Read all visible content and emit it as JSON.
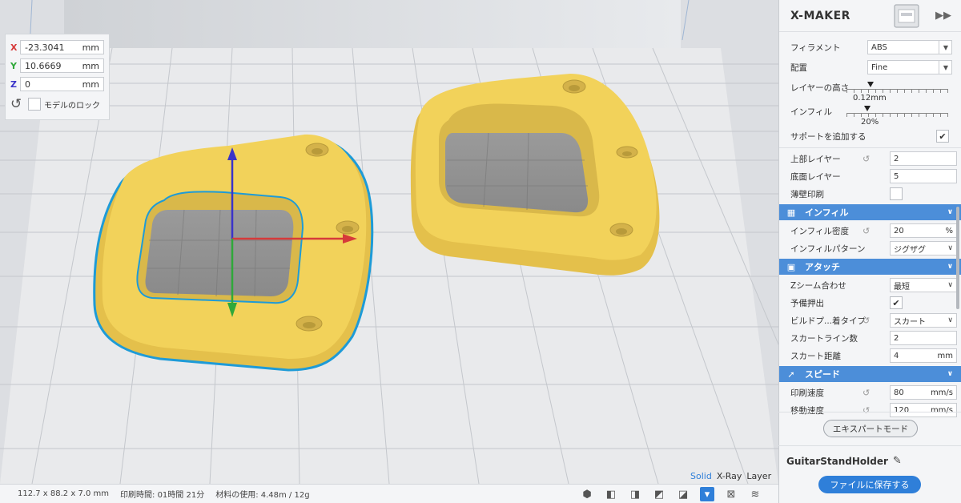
{
  "transform": {
    "x_label": "X",
    "x_value": "-23.3041",
    "x_unit": "mm",
    "y_label": "Y",
    "y_value": "10.6669",
    "y_unit": "mm",
    "z_label": "Z",
    "z_value": "0",
    "z_unit": "mm",
    "lock_label": "モデルのロック",
    "icons": {
      "reset": "rotate-left-icon"
    }
  },
  "view_modes": {
    "solid": "Solid",
    "xray": "X-Ray",
    "layer": "Layer",
    "active": "solid"
  },
  "status_bar": {
    "dimensions": "112.7 x 88.2 x 7.0 mm",
    "print_time": "印刷時間: 01時間 21分",
    "material": "材料の使用: 4.48m / 12g"
  },
  "panel": {
    "title": "X-MAKER",
    "filament_label": "フィラメント",
    "filament_value": "ABS",
    "profile_label": "配置",
    "profile_value": "Fine",
    "layer_height_label": "レイヤーの高さ",
    "layer_height_value": "0.12mm",
    "layer_height_fraction": 0.08,
    "infill_label": "インフィル",
    "infill_value": "20%",
    "infill_fraction": 0.2,
    "support_label": "サポートを追加する",
    "support_checked": true,
    "top_layers_label": "上部レイヤー",
    "top_layers_value": "2",
    "bottom_layers_label": "底面レイヤー",
    "bottom_layers_value": "5",
    "thin_wall_label": "薄壁印刷",
    "thin_wall_checked": false,
    "section_infill": "インフィル",
    "infill_density_label": "インフィル密度",
    "infill_density_value": "20",
    "infill_density_unit": "%",
    "infill_pattern_label": "インフィルパターン",
    "infill_pattern_value": "ジグザグ",
    "section_attach": "アタッチ",
    "z_seam_label": "Zシーム合わせ",
    "z_seam_value": "最短",
    "prime_label": "予備押出",
    "prime_checked": true,
    "build_plate_label": "ビルドプ...着タイプ",
    "build_plate_value": "スカート",
    "skirt_lines_label": "スカートライン数",
    "skirt_lines_value": "2",
    "skirt_distance_label": "スカート距離",
    "skirt_distance_value": "4",
    "skirt_distance_unit": "mm",
    "section_speed": "スピード",
    "print_speed_label": "印刷速度",
    "print_speed_value": "80",
    "print_speed_unit": "mm/s",
    "travel_speed_label": "移動速度",
    "travel_speed_value": "120",
    "travel_speed_unit": "mm/s",
    "expert_mode": "エキスパートモード",
    "file_name": "GuitarStandHolder",
    "save_button": "ファイルに保存する"
  },
  "colors": {
    "accent": "#2f7fd9",
    "section": "#4c8ed9",
    "model": "#f2d25a",
    "selection": "#1e9bd7"
  }
}
